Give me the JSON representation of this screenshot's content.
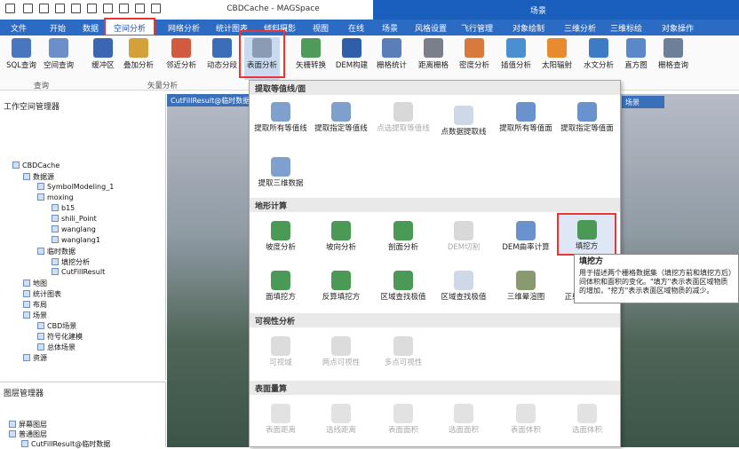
{
  "window": {
    "title": "CBDCache - MAGSpace",
    "scene_title": "场景"
  },
  "menu": {
    "tabs": [
      "文件",
      "开始",
      "数据",
      "空间分析",
      "网络分析",
      "统计图表",
      "倾斜摄影",
      "视图",
      "在线",
      "场景",
      "风格设置",
      "飞行管理",
      "对象绘制",
      "三维分析",
      "三维标绘",
      "对象操作"
    ],
    "active": "空间分析"
  },
  "ribbon": {
    "buttons": [
      "SQL查询",
      "空间查询",
      "缓冲区",
      "叠加分析",
      "邻近分析",
      "动态分段",
      "表面分析",
      "矢栅转换",
      "DEM构建",
      "栅格统计",
      "距离栅格",
      "密度分析",
      "插值分析",
      "太阳辐射",
      "水文分析",
      "直方图",
      "栅格查询"
    ],
    "groups": [
      "查询",
      "矢量分析"
    ]
  },
  "workspace": {
    "title": "工作空间管理器",
    "tree": [
      "CBDCache",
      "数据源",
      "SymbolModeling_1",
      "moxing",
      "b15",
      "shili_Point",
      "wanglang",
      "wanglang1",
      "临时数据",
      "填挖分析",
      "CutFillResult",
      "地图",
      "统计图表",
      "布局",
      "场景",
      "CBD场景",
      "符号化建模",
      "总体场景",
      "资源"
    ]
  },
  "layers": {
    "title": "图层管理器",
    "items": [
      "屏幕图层",
      "普通图层",
      "CutFillResult@临时数据"
    ]
  },
  "doc": {
    "tab": "CutFillResult@临时数据",
    "scene_tab": "场景"
  },
  "dropdown": {
    "sections": [
      "提取等值线/面",
      "地形计算",
      "可视性分析",
      "表面量算"
    ],
    "contour": [
      "提取所有等值线",
      "提取指定等值线",
      "点选提取等值线",
      "点数据提取线",
      "提取所有等值面",
      "提取指定等值面",
      "提取三维数据"
    ],
    "terrain": [
      "坡度分析",
      "坡向分析",
      "剖面分析",
      "DEM切割",
      "DEM曲率计算",
      "填挖方",
      "面填挖方",
      "反算填挖方",
      "区域查找极值",
      "绘面查找极值",
      "三维晕渲图",
      "正射三维影像"
    ],
    "visibility": [
      "可视域",
      "两点可视性",
      "多点可视性"
    ],
    "measure": [
      "表面距离",
      "选线距离",
      "表面面积",
      "选面面积",
      "表面体积",
      "选面体积"
    ]
  },
  "tooltip": {
    "title": "填挖方",
    "body": "用于描述两个栅格数据集（填挖方前和填挖方后）间体积和面积的变化。\"填方\"表示表面区域物质的增加，\"挖方\"表示表面区域物质的减少。"
  }
}
